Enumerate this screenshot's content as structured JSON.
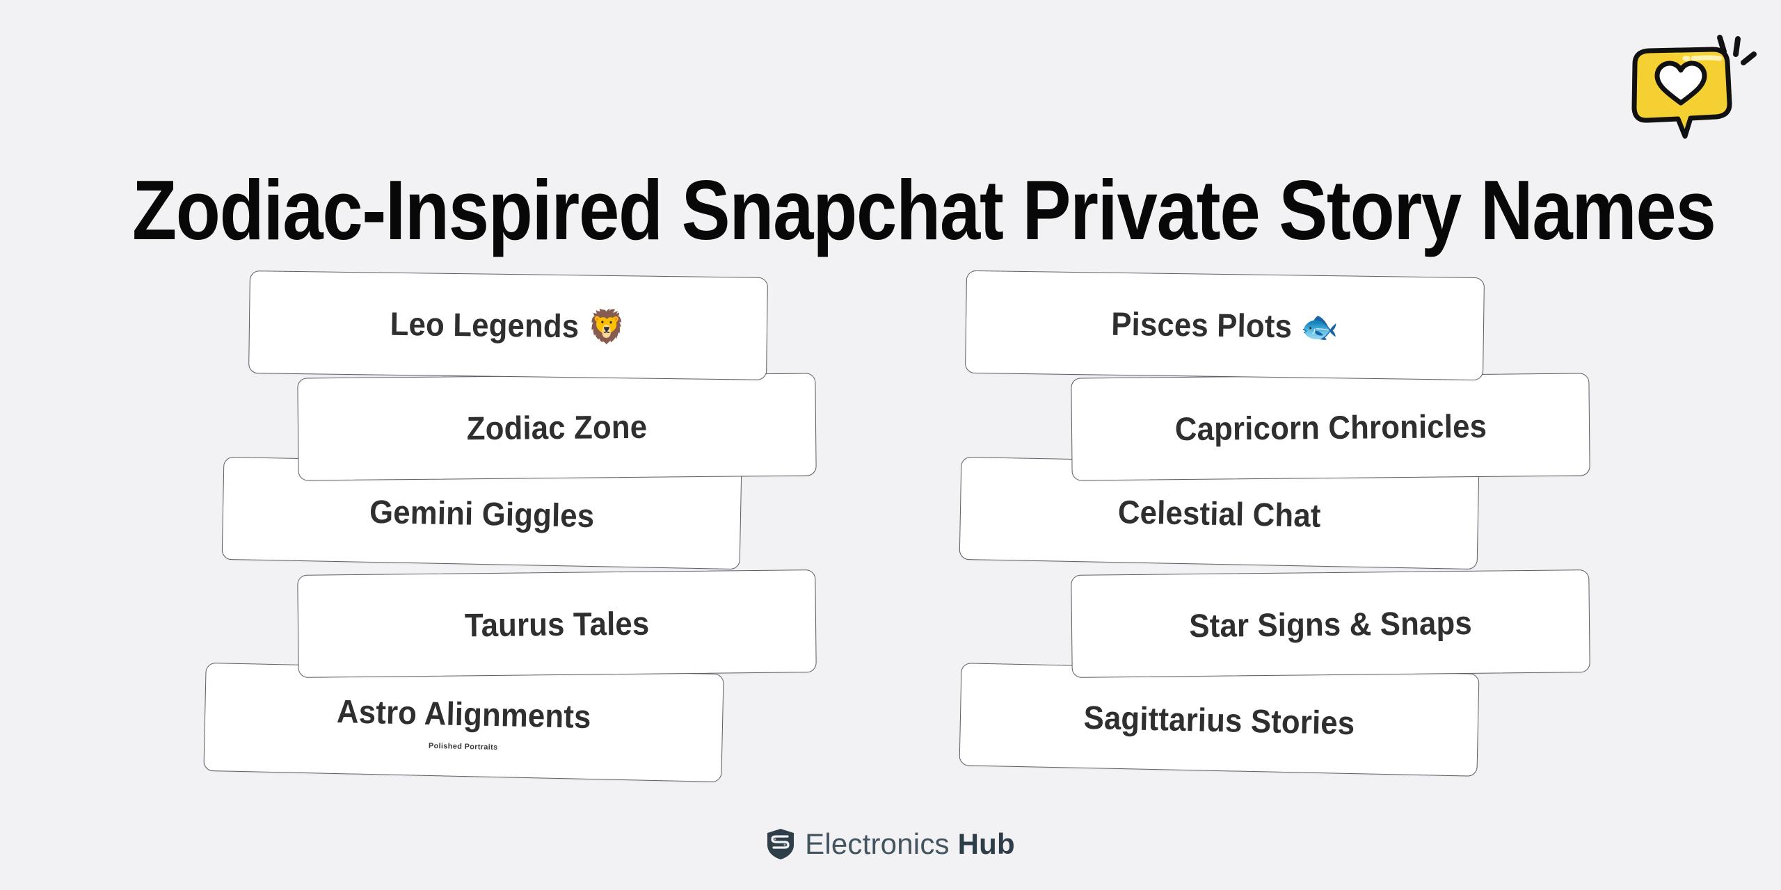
{
  "page": {
    "background_color": "#f2f2f4",
    "title": "Zodiac-Inspired Snapchat Private Story Names"
  },
  "badge": {
    "icon_name": "heart-speech-bubble-icon",
    "bubble_color": "#f5d033",
    "heart_color": "#ffffff",
    "outline_color": "#111111"
  },
  "columns": [
    {
      "id": "left",
      "cards": [
        {
          "label": "Leo Legends 🦁",
          "sublabel": ""
        },
        {
          "label": "Zodiac Zone",
          "sublabel": ""
        },
        {
          "label": "Gemini Giggles",
          "sublabel": ""
        },
        {
          "label": "Taurus Tales",
          "sublabel": ""
        },
        {
          "label": "Astro Alignments",
          "sublabel": "Polished Portraits"
        }
      ]
    },
    {
      "id": "right",
      "cards": [
        {
          "label": "Pisces Plots 🐟",
          "sublabel": ""
        },
        {
          "label": "Capricorn Chronicles",
          "sublabel": ""
        },
        {
          "label": "Celestial Chat",
          "sublabel": ""
        },
        {
          "label": "Star Signs & Snaps",
          "sublabel": ""
        },
        {
          "label": "Sagittarius Stories",
          "sublabel": ""
        }
      ]
    }
  ],
  "footer": {
    "logo_icon_name": "shield-logo-icon",
    "brand_light": "Electronics",
    "brand_bold": "Hub",
    "brand_color": "#3a4a55"
  }
}
